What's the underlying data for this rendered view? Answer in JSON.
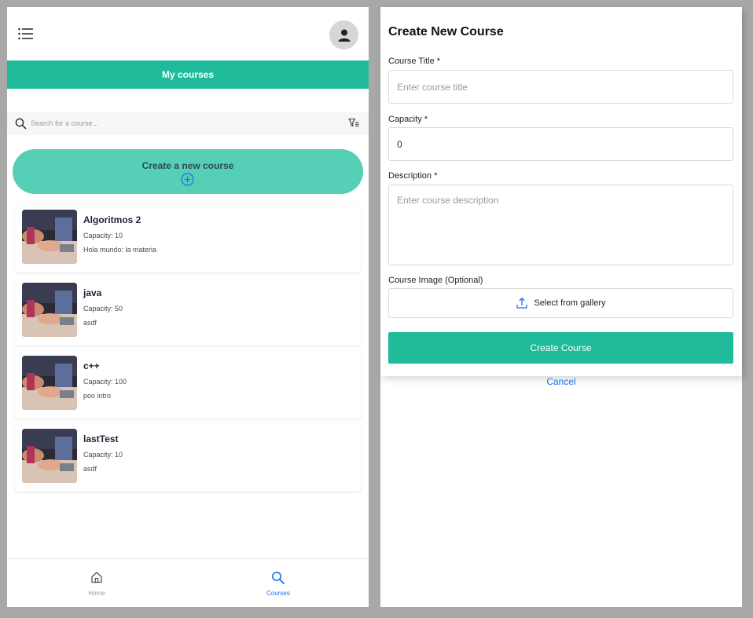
{
  "courses_screen": {
    "header_title": "My courses",
    "search_placeholder": "Search for a course...",
    "create_label": "Create a new course",
    "courses": [
      {
        "title": "Algoritmos 2",
        "capacity": "Capacity: 10",
        "description": "Hola mundo: la materia"
      },
      {
        "title": "java",
        "capacity": "Capacity: 50",
        "description": "asdf"
      },
      {
        "title": "c++",
        "capacity": "Capacity: 100",
        "description": "poo intro"
      },
      {
        "title": "lastTest",
        "capacity": "Capacity: 10",
        "description": "asdf"
      }
    ],
    "nav": {
      "home": "Home",
      "courses": "Courses"
    }
  },
  "create_form": {
    "title": "Create New Course",
    "course_title_label": "Course Title *",
    "course_title_placeholder": "Enter course title",
    "capacity_label": "Capacity *",
    "capacity_value": "0",
    "description_label": "Description *",
    "description_placeholder": "Enter course description",
    "image_label": "Course Image (Optional)",
    "gallery_button": "Select from gallery",
    "submit_button": "Create Course",
    "cancel_link": "Cancel"
  },
  "colors": {
    "accent": "#1fbb9a",
    "accent_light": "#55cfb5",
    "link": "#1a73e8"
  },
  "icons": [
    "menu-icon",
    "avatar-icon",
    "search-icon",
    "filter-icon",
    "plus-circle-icon",
    "home-icon",
    "courses-search-icon",
    "upload-icon"
  ]
}
